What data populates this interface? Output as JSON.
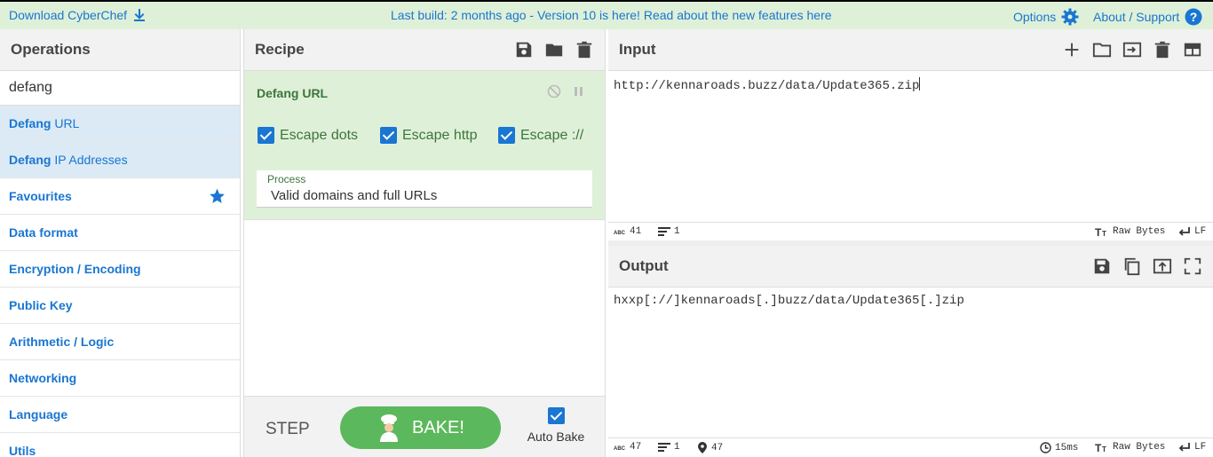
{
  "topbar": {
    "download_label": "Download CyberChef",
    "build_message": "Last build: 2 months ago - Version 10 is here! Read about the new features here",
    "options_label": "Options",
    "about_label": "About / Support"
  },
  "operations": {
    "title": "Operations",
    "search_value": "defang",
    "results": [
      {
        "match": "Defang",
        "rest": " URL"
      },
      {
        "match": "Defang",
        "rest": " IP Addresses"
      }
    ],
    "categories": [
      "Favourites",
      "Data format",
      "Encryption / Encoding",
      "Public Key",
      "Arithmetic / Logic",
      "Networking",
      "Language",
      "Utils"
    ]
  },
  "recipe": {
    "title": "Recipe",
    "operation_name": "Defang URL",
    "checkboxes": [
      "Escape dots",
      "Escape http",
      "Escape ://"
    ],
    "process_label": "Process",
    "process_value": "Valid domains and full URLs",
    "step_label": "STEP",
    "bake_label": "BAKE!",
    "autobake_label": "Auto Bake"
  },
  "input": {
    "title": "Input",
    "text": "http://kennaroads.buzz/data/Update365.zip",
    "length": "41",
    "lines": "1",
    "encoding": "Raw Bytes",
    "eol": "LF"
  },
  "output": {
    "title": "Output",
    "text": "hxxp[://]kennaroads[.]buzz/data/Update365[.]zip",
    "length": "47",
    "lines": "1",
    "position": "47",
    "time": "15ms",
    "encoding": "Raw Bytes",
    "eol": "LF"
  },
  "colors": {
    "accent": "#1976d2",
    "recipe_bg": "#dff0d8",
    "bake": "#5cb85c",
    "highlight": "#dbeaf5"
  }
}
